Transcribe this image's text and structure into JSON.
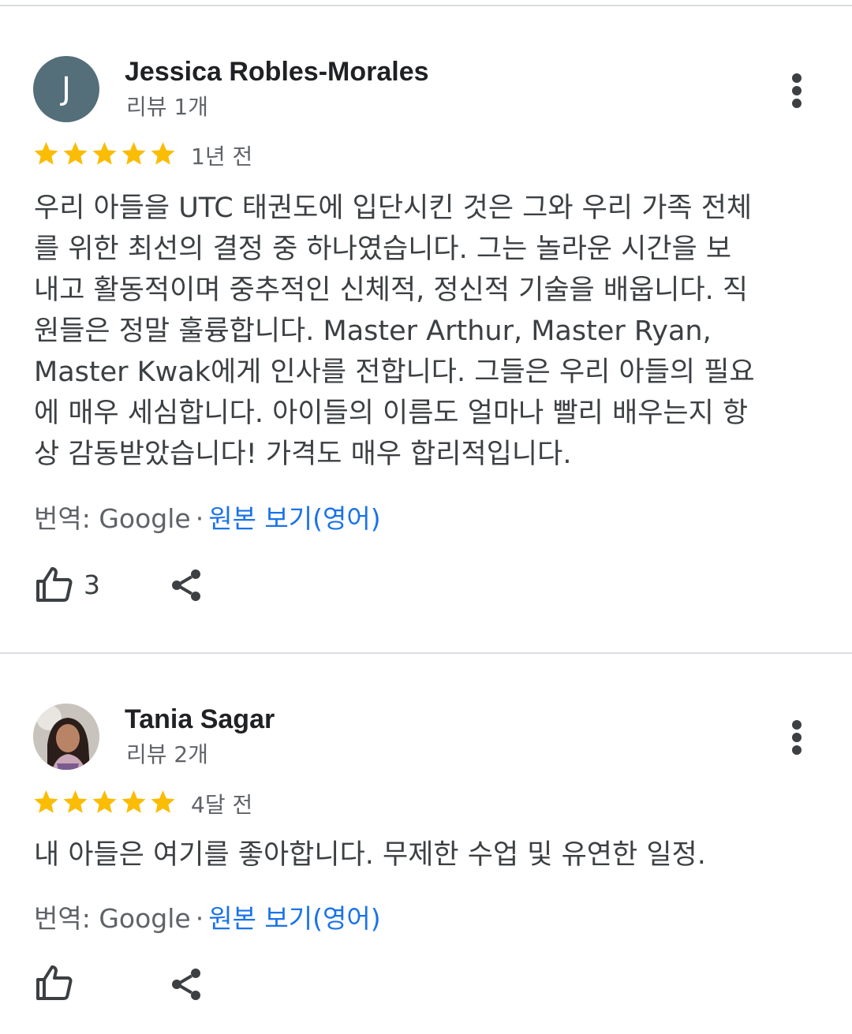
{
  "reviews": [
    {
      "avatar_letter": "J",
      "avatar_color": "#546e7a",
      "name": "Jessica Robles-Morales",
      "review_count": "리뷰 1개",
      "rating": 5,
      "date": "1년 전",
      "text": "우리 아들을 UTC 태권도에 입단시킨 것은 그와 우리 가족 전체\n를 위한 최선의 결정 중 하나였습니다. 그는 놀라운 시간을 보\n내고 활동적이며 중추적인 신체적, 정신적 기술을 배웁니다. 직\n원들은 정말 훌륭합니다. Master Arthur, Master Ryan,\nMaster Kwak에게 인사를 전합니다. 그들은 우리 아들의 필요\n에 매우 세심합니다. 아이들의 이름도 얼마나 빨리 배우는지 항\n상 감동받았습니다! 가격도 매우 합리적입니다.",
      "translated_by": "번역: Google",
      "separator": "·",
      "view_original": "원본 보기(영어)",
      "likes": "3"
    },
    {
      "avatar_letter": "",
      "name": "Tania Sagar",
      "review_count": "리뷰 2개",
      "rating": 5,
      "date": "4달 전",
      "text": "내 아들은 여기를 좋아합니다. 무제한 수업 및 유연한 일정.",
      "translated_by": "번역: Google",
      "separator": "·",
      "view_original": "원본 보기(영어)",
      "likes": ""
    }
  ],
  "colors": {
    "star": "#fbbc04",
    "link": "#1a73e8",
    "divider": "#dadce0"
  },
  "icons": {
    "star": "star-icon",
    "more": "more-vert-icon",
    "like": "thumb-up-icon",
    "share": "share-icon"
  }
}
